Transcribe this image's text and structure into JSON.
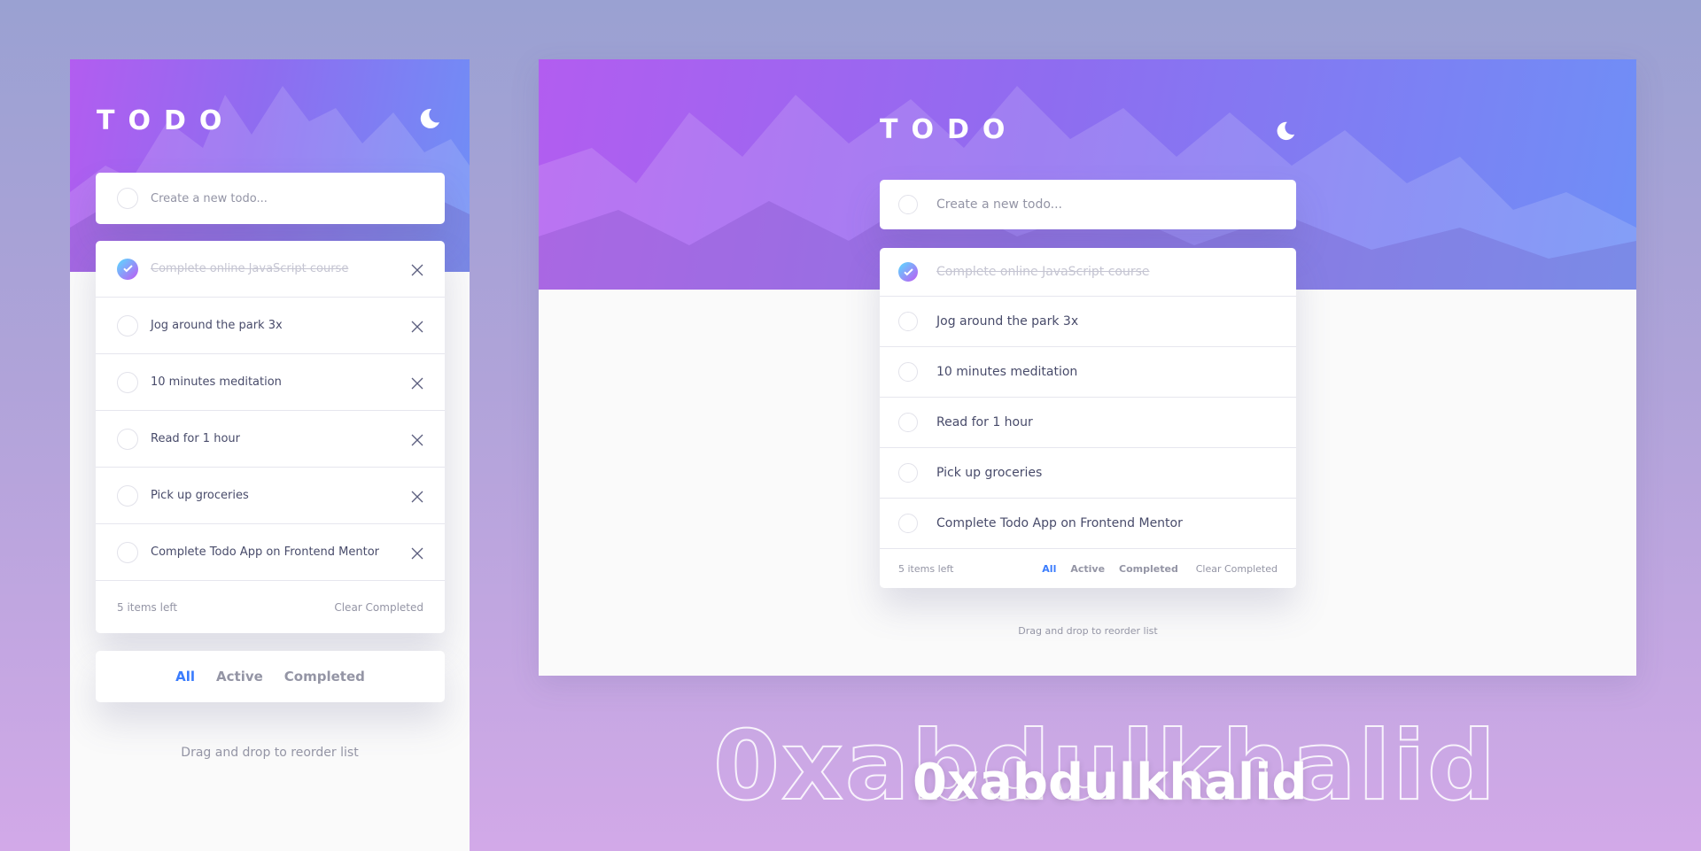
{
  "app": {
    "logo": "TODO",
    "new_todo_placeholder": "Create a new todo...",
    "accent_color": "#3a7cfd",
    "gradient": [
      "#57ddff",
      "#c058f3"
    ],
    "theme_toggle_icon": "moon-icon"
  },
  "mobile": {
    "todos": [
      {
        "text": "Complete online JavaScript course",
        "completed": true
      },
      {
        "text": "Jog around the park 3x",
        "completed": false
      },
      {
        "text": "10 minutes meditation",
        "completed": false
      },
      {
        "text": "Read for 1 hour",
        "completed": false
      },
      {
        "text": "Pick up groceries",
        "completed": false
      },
      {
        "text": "Complete Todo App on Frontend Mentor",
        "completed": false
      }
    ],
    "items_left": "5 items left",
    "clear_completed": "Clear Completed",
    "filters": [
      "All",
      "Active",
      "Completed"
    ],
    "active_filter": "All",
    "hint": "Drag and drop to reorder list"
  },
  "desktop": {
    "todos": [
      {
        "text": "Complete online JavaScript course",
        "completed": true
      },
      {
        "text": "Jog around the park 3x",
        "completed": false
      },
      {
        "text": "10 minutes meditation",
        "completed": false
      },
      {
        "text": "Read for 1 hour",
        "completed": false
      },
      {
        "text": "Pick up groceries",
        "completed": false
      },
      {
        "text": "Complete Todo App on Frontend Mentor",
        "completed": false
      }
    ],
    "items_left": "5 items left",
    "clear_completed": "Clear Completed",
    "filters": [
      "All",
      "Active",
      "Completed"
    ],
    "active_filter": "All",
    "hint": "Drag and drop to reorder list"
  },
  "watermark": {
    "outline_text": "0xabdulkhalid",
    "solid_text": "0xabdulkhalid"
  }
}
